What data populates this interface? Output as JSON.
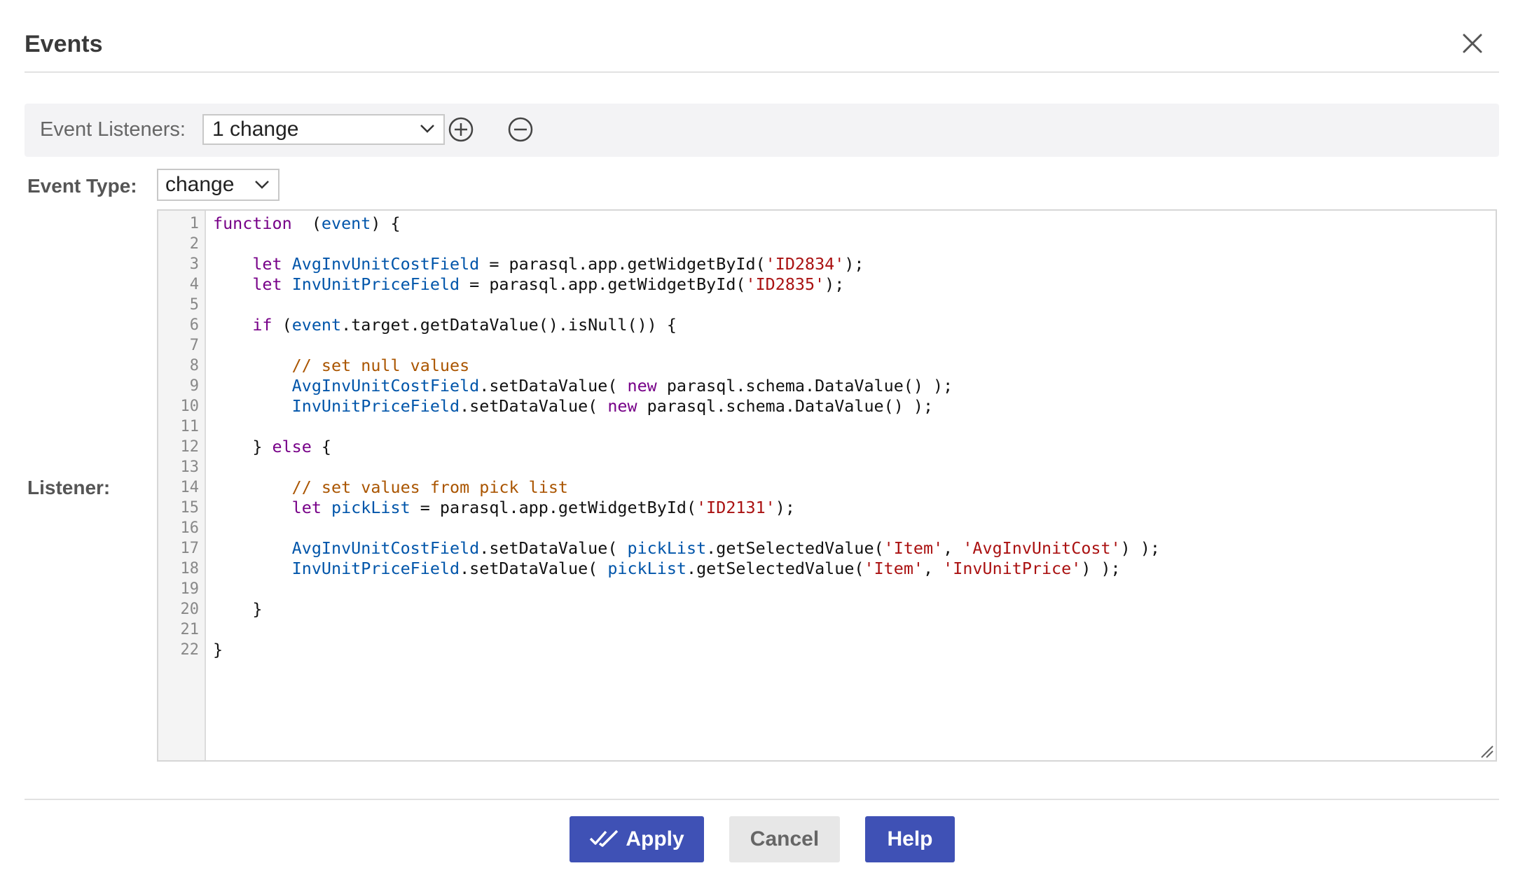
{
  "dialog": {
    "title": "Events",
    "close_icon": "close-icon"
  },
  "listeners": {
    "label": "Event Listeners:",
    "selected": "1 change",
    "add_icon": "plus-circle-icon",
    "remove_icon": "minus-circle-icon"
  },
  "event_type": {
    "label": "Event Type:",
    "selected": "change"
  },
  "listener": {
    "label": "Listener:"
  },
  "code": {
    "line_numbers": [
      "1",
      "2",
      "3",
      "4",
      "5",
      "6",
      "7",
      "8",
      "9",
      "10",
      "11",
      "12",
      "13",
      "14",
      "15",
      "16",
      "17",
      "18",
      "19",
      "20",
      "21",
      "22"
    ],
    "lines": [
      [
        [
          "kw",
          "function"
        ],
        [
          "",
          "  ("
        ],
        [
          "vr",
          "event"
        ],
        [
          "",
          ") {"
        ]
      ],
      [],
      [
        [
          "",
          "    "
        ],
        [
          "kw",
          "let"
        ],
        [
          "",
          " "
        ],
        [
          "vr",
          "AvgInvUnitCostField"
        ],
        [
          "",
          " = parasql.app.getWidgetById("
        ],
        [
          "st",
          "'ID2834'"
        ],
        [
          "",
          ");"
        ]
      ],
      [
        [
          "",
          "    "
        ],
        [
          "kw",
          "let"
        ],
        [
          "",
          " "
        ],
        [
          "vr",
          "InvUnitPriceField"
        ],
        [
          "",
          " = parasql.app.getWidgetById("
        ],
        [
          "st",
          "'ID2835'"
        ],
        [
          "",
          ");"
        ]
      ],
      [],
      [
        [
          "",
          "    "
        ],
        [
          "kw",
          "if"
        ],
        [
          "",
          " ("
        ],
        [
          "vr",
          "event"
        ],
        [
          "",
          ".target.getDataValue().isNull()) {"
        ]
      ],
      [],
      [
        [
          "",
          "        "
        ],
        [
          "cm",
          "// set null values"
        ]
      ],
      [
        [
          "",
          "        "
        ],
        [
          "vr",
          "AvgInvUnitCostField"
        ],
        [
          "",
          ".setDataValue( "
        ],
        [
          "kw",
          "new"
        ],
        [
          "",
          " parasql.schema.DataValue() );"
        ]
      ],
      [
        [
          "",
          "        "
        ],
        [
          "vr",
          "InvUnitPriceField"
        ],
        [
          "",
          ".setDataValue( "
        ],
        [
          "kw",
          "new"
        ],
        [
          "",
          " parasql.schema.DataValue() );"
        ]
      ],
      [],
      [
        [
          "",
          "    } "
        ],
        [
          "kw",
          "else"
        ],
        [
          "",
          " {"
        ]
      ],
      [],
      [
        [
          "",
          "        "
        ],
        [
          "cm",
          "// set values from pick list"
        ]
      ],
      [
        [
          "",
          "        "
        ],
        [
          "kw",
          "let"
        ],
        [
          "",
          " "
        ],
        [
          "vr",
          "pickList"
        ],
        [
          "",
          " = parasql.app.getWidgetById("
        ],
        [
          "st",
          "'ID2131'"
        ],
        [
          "",
          ");"
        ]
      ],
      [],
      [
        [
          "",
          "        "
        ],
        [
          "vr",
          "AvgInvUnitCostField"
        ],
        [
          "",
          ".setDataValue( "
        ],
        [
          "vr",
          "pickList"
        ],
        [
          "",
          ".getSelectedValue("
        ],
        [
          "st",
          "'Item'"
        ],
        [
          "",
          ", "
        ],
        [
          "st",
          "'AvgInvUnitCost'"
        ],
        [
          "",
          ") );"
        ]
      ],
      [
        [
          "",
          "        "
        ],
        [
          "vr",
          "InvUnitPriceField"
        ],
        [
          "",
          ".setDataValue( "
        ],
        [
          "vr",
          "pickList"
        ],
        [
          "",
          ".getSelectedValue("
        ],
        [
          "st",
          "'Item'"
        ],
        [
          "",
          ", "
        ],
        [
          "st",
          "'InvUnitPrice'"
        ],
        [
          "",
          ") );"
        ]
      ],
      [],
      [
        [
          "",
          "    }"
        ]
      ],
      [],
      [
        [
          "",
          "}"
        ]
      ]
    ]
  },
  "buttons": {
    "apply": "Apply",
    "cancel": "Cancel",
    "help": "Help"
  },
  "colors": {
    "primary": "#3f51b5",
    "keyword": "#770088",
    "variable": "#0055aa",
    "string": "#aa1111",
    "comment": "#aa5500"
  }
}
